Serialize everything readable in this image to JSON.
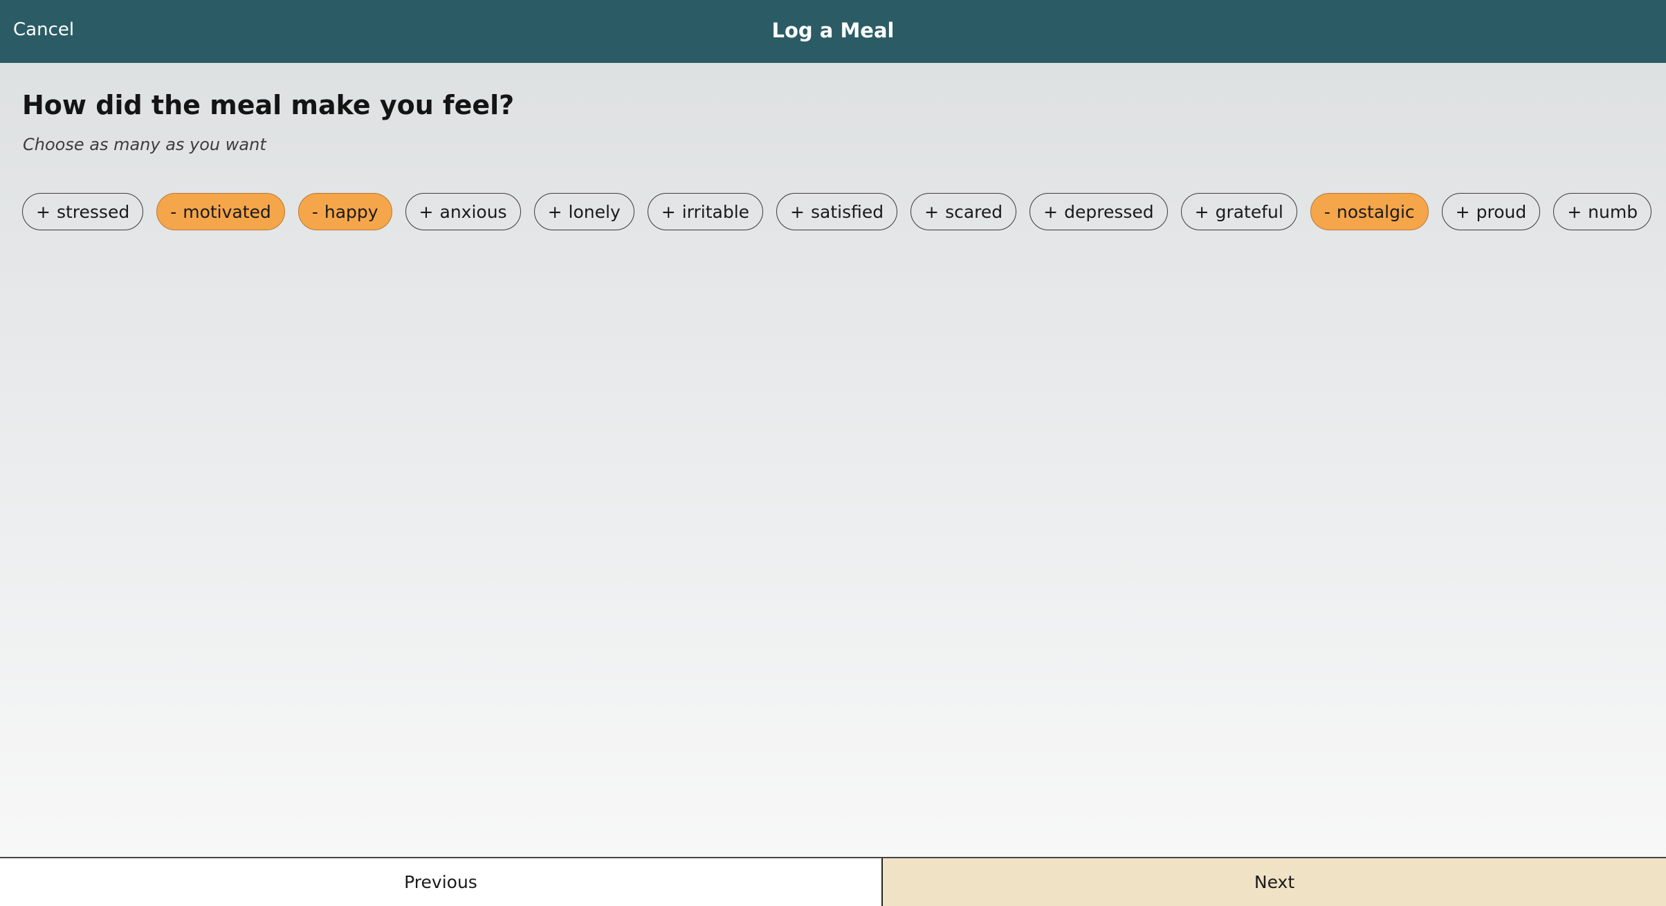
{
  "header": {
    "cancel_label": "Cancel",
    "title": "Log a Meal"
  },
  "question": {
    "title": "How did the meal make you feel?",
    "hint": "Choose as many as you want"
  },
  "feelings": [
    {
      "label": "stressed",
      "sign": "+",
      "selected": false
    },
    {
      "label": "motivated",
      "sign": "-",
      "selected": true
    },
    {
      "label": "happy",
      "sign": "-",
      "selected": true
    },
    {
      "label": "anxious",
      "sign": "+",
      "selected": false
    },
    {
      "label": "lonely",
      "sign": "+",
      "selected": false
    },
    {
      "label": "irritable",
      "sign": "+",
      "selected": false
    },
    {
      "label": "satisfied",
      "sign": "+",
      "selected": false
    },
    {
      "label": "scared",
      "sign": "+",
      "selected": false
    },
    {
      "label": "depressed",
      "sign": "+",
      "selected": false
    },
    {
      "label": "grateful",
      "sign": "+",
      "selected": false
    },
    {
      "label": "nostalgic",
      "sign": "-",
      "selected": true
    },
    {
      "label": "proud",
      "sign": "+",
      "selected": false
    },
    {
      "label": "numb",
      "sign": "+",
      "selected": false
    }
  ],
  "footer": {
    "previous_label": "Previous",
    "next_label": "Next"
  },
  "colors": {
    "header_bg": "#2b5c65",
    "selected_chip": "#f5a64a",
    "next_button_bg": "#f0e2c4"
  }
}
